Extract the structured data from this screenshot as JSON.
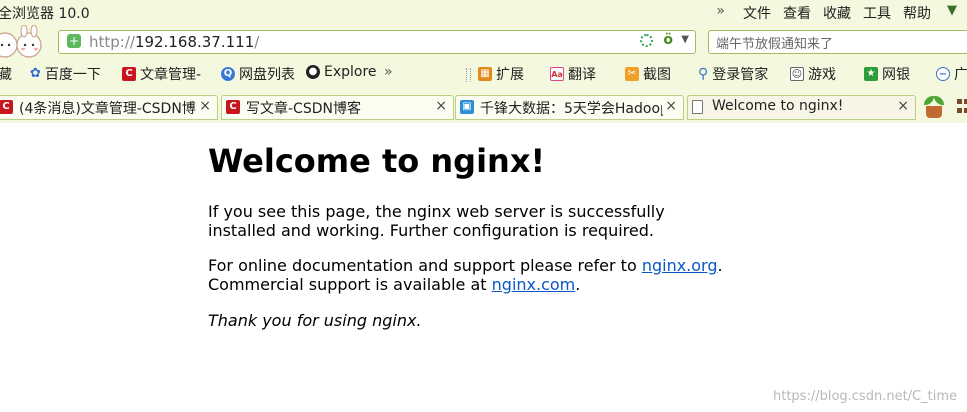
{
  "browser": {
    "title": "全浏览器 10.0",
    "menu": [
      "»",
      "文件",
      "查看",
      "收藏",
      "工具",
      "帮助"
    ],
    "address": {
      "scheme": "http://",
      "host": "192.168.37.111",
      "path": "/"
    },
    "search_placeholder": "端午节放假通知来了"
  },
  "favorites": {
    "first": "藏",
    "items": [
      "百度一下",
      "文章管理-",
      "网盘列表",
      "Explore"
    ],
    "more": "»",
    "tools": [
      "扩展",
      "翻译",
      "截图",
      "登录管家",
      "游戏",
      "网银",
      "广"
    ]
  },
  "tabs": [
    {
      "label": "(4条消息)文章管理-CSDN博",
      "icon": "csdn-icon",
      "close": "×"
    },
    {
      "label": "写文章-CSDN博客",
      "icon": "csdn-icon",
      "close": "×"
    },
    {
      "label": "千锋大数据：5天学会Hadoop",
      "icon": "tv-icon",
      "close": "×"
    },
    {
      "label": "Welcome to nginx!",
      "icon": "page-icon",
      "close": "×"
    }
  ],
  "page": {
    "heading": "Welcome to nginx!",
    "p1": "If you see this page, the nginx web server is successfully installed and working. Further configuration is required.",
    "p2_before": "For online documentation and support please refer to ",
    "link1": "nginx.org",
    "p2_mid": ".",
    "p2_line2": "Commercial support is available at ",
    "link2": "nginx.com",
    "p2_end": ".",
    "p3": "Thank you for using nginx."
  },
  "watermark": "https://blog.csdn.net/C_time"
}
